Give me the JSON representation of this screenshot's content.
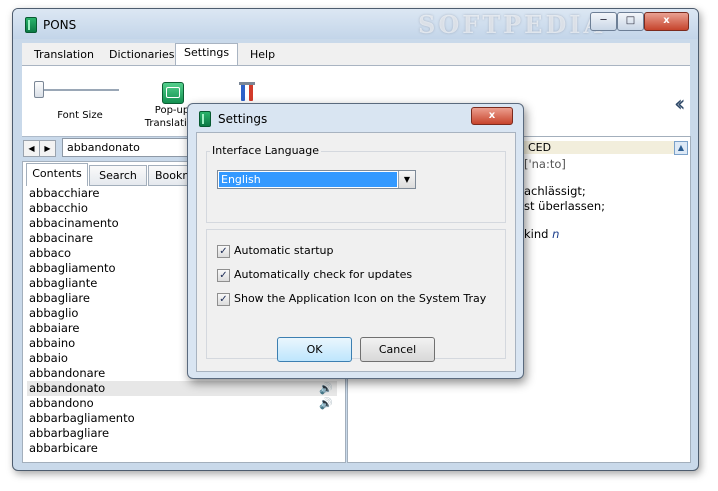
{
  "window": {
    "title": "PONS",
    "watermark": "SOFTPEDIA",
    "controls": {
      "minimize": "─",
      "maximize": "□",
      "close": "x"
    }
  },
  "menu": {
    "tabs": [
      "Translation",
      "Dictionaries",
      "Settings",
      "Help"
    ],
    "active": "Settings"
  },
  "ribbon": {
    "font_size_label": "Font Size",
    "popup_label_line1": "Pop-up",
    "popup_label_line2": "Translation",
    "collapse_glyph": "‹‹"
  },
  "search": {
    "back_glyph": "◀",
    "forward_glyph": "▶",
    "value": "abbandonato"
  },
  "left_panel": {
    "tabs": [
      "Contents",
      "Search",
      "Bookm"
    ],
    "active_tab": "Contents",
    "words": [
      "abbacchiare",
      "abbacchio",
      "abbacinamento",
      "abbacinare",
      "abbaco",
      "abbagliamento",
      "abbagliante",
      "abbagliare",
      "abbaglio",
      "abbaiare",
      "abbaino",
      "abbaio",
      "abbandonare",
      "abbandonato",
      "abbandono",
      "abbarbagliamento",
      "abbarbagliare",
      "abbarbicare"
    ],
    "selected_word": "abbandonato",
    "speaker_glyph": "🔊"
  },
  "right_panel": {
    "header_text": "CED",
    "scroll_up_glyph": "▲",
    "phonetic": "['na:to]",
    "line1": "achlässigt;",
    "line2": "st überlassen;",
    "line3": "kind",
    "line3_pos": "n"
  },
  "dialog": {
    "title": "Settings",
    "close_glyph": "x",
    "interface_language_label": "Interface Language",
    "language_value": "English",
    "dropdown_glyph": "▼",
    "checkboxes": [
      {
        "label": "Automatic startup",
        "checked": true
      },
      {
        "label": "Automatically check for updates",
        "checked": true
      },
      {
        "label": "Show the Application Icon on the System Tray",
        "checked": true
      }
    ],
    "check_glyph": "✓",
    "ok_label": "OK",
    "cancel_label": "Cancel"
  }
}
